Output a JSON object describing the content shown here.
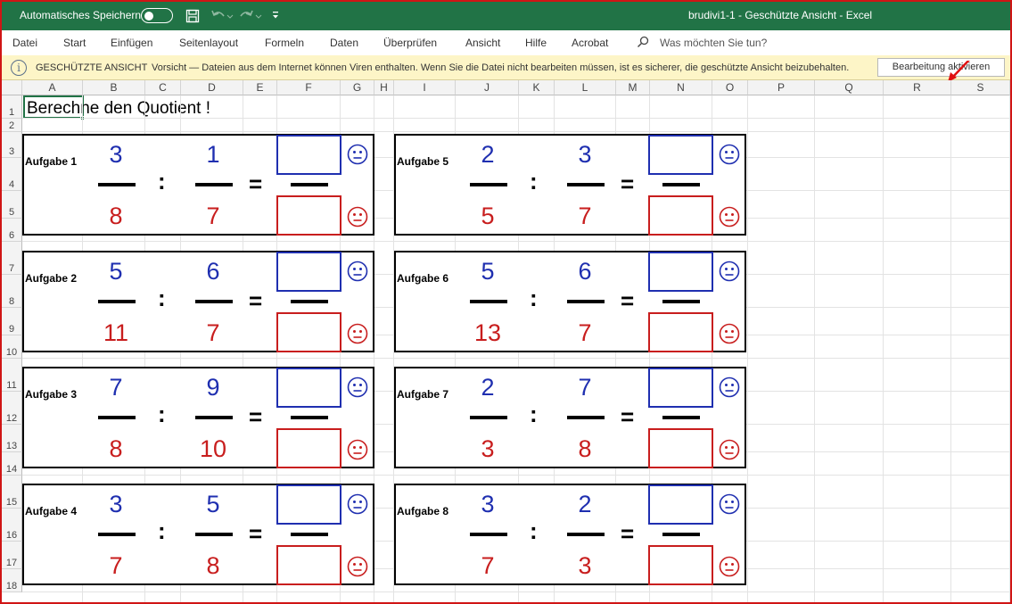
{
  "titlebar": {
    "autosave_label": "Automatisches Speichern",
    "document_title": "brudivi1-1  -  Geschützte Ansicht  -  Excel"
  },
  "ribbon": {
    "tabs": [
      "Datei",
      "Start",
      "Einfügen",
      "Seitenlayout",
      "Formeln",
      "Daten",
      "Überprüfen",
      "Ansicht",
      "Hilfe",
      "Acrobat"
    ],
    "search_placeholder": "Was möchten Sie tun?"
  },
  "protected_view": {
    "title": "GESCHÜTZTE ANSICHT",
    "message": "Vorsicht — Dateien aus dem Internet können Viren enthalten. Wenn Sie die Datei nicht bearbeiten müssen, ist es sicherer, die geschützte Ansicht beizubehalten.",
    "button_label": "Bearbeitung aktivieren"
  },
  "sheet": {
    "columns": [
      "A",
      "B",
      "C",
      "D",
      "E",
      "F",
      "G",
      "H",
      "I",
      "J",
      "K",
      "L",
      "M",
      "N",
      "O",
      "P",
      "Q",
      "R",
      "S"
    ],
    "rows": [
      "1",
      "2",
      "3",
      "4",
      "5",
      "6",
      "7",
      "8",
      "9",
      "10",
      "11",
      "12",
      "13",
      "14",
      "15",
      "16",
      "17",
      "18"
    ],
    "title": "Berechne den Quotient !",
    "operator_divide": ":",
    "operator_equals": "=",
    "tasks": [
      {
        "label": "Aufgabe 1",
        "n1": "3",
        "d1": "8",
        "n2": "1",
        "d2": "7"
      },
      {
        "label": "Aufgabe 2",
        "n1": "5",
        "d1": "11",
        "n2": "6",
        "d2": "7"
      },
      {
        "label": "Aufgabe 3",
        "n1": "7",
        "d1": "8",
        "n2": "9",
        "d2": "10"
      },
      {
        "label": "Aufgabe 4",
        "n1": "3",
        "d1": "7",
        "n2": "5",
        "d2": "8"
      },
      {
        "label": "Aufgabe 5",
        "n1": "2",
        "d1": "5",
        "n2": "3",
        "d2": "7"
      },
      {
        "label": "Aufgabe 6",
        "n1": "5",
        "d1": "13",
        "n2": "6",
        "d2": "7"
      },
      {
        "label": "Aufgabe 7",
        "n1": "2",
        "d1": "3",
        "n2": "7",
        "d2": "8"
      },
      {
        "label": "Aufgabe 8",
        "n1": "3",
        "d1": "7",
        "n2": "2",
        "d2": "3"
      }
    ]
  },
  "colors": {
    "excel_green": "#217346",
    "numerator_blue": "#1f2fb0",
    "denominator_red": "#c81e1e",
    "protected_bar": "#fdf5c7",
    "frame_red": "#d01515"
  }
}
